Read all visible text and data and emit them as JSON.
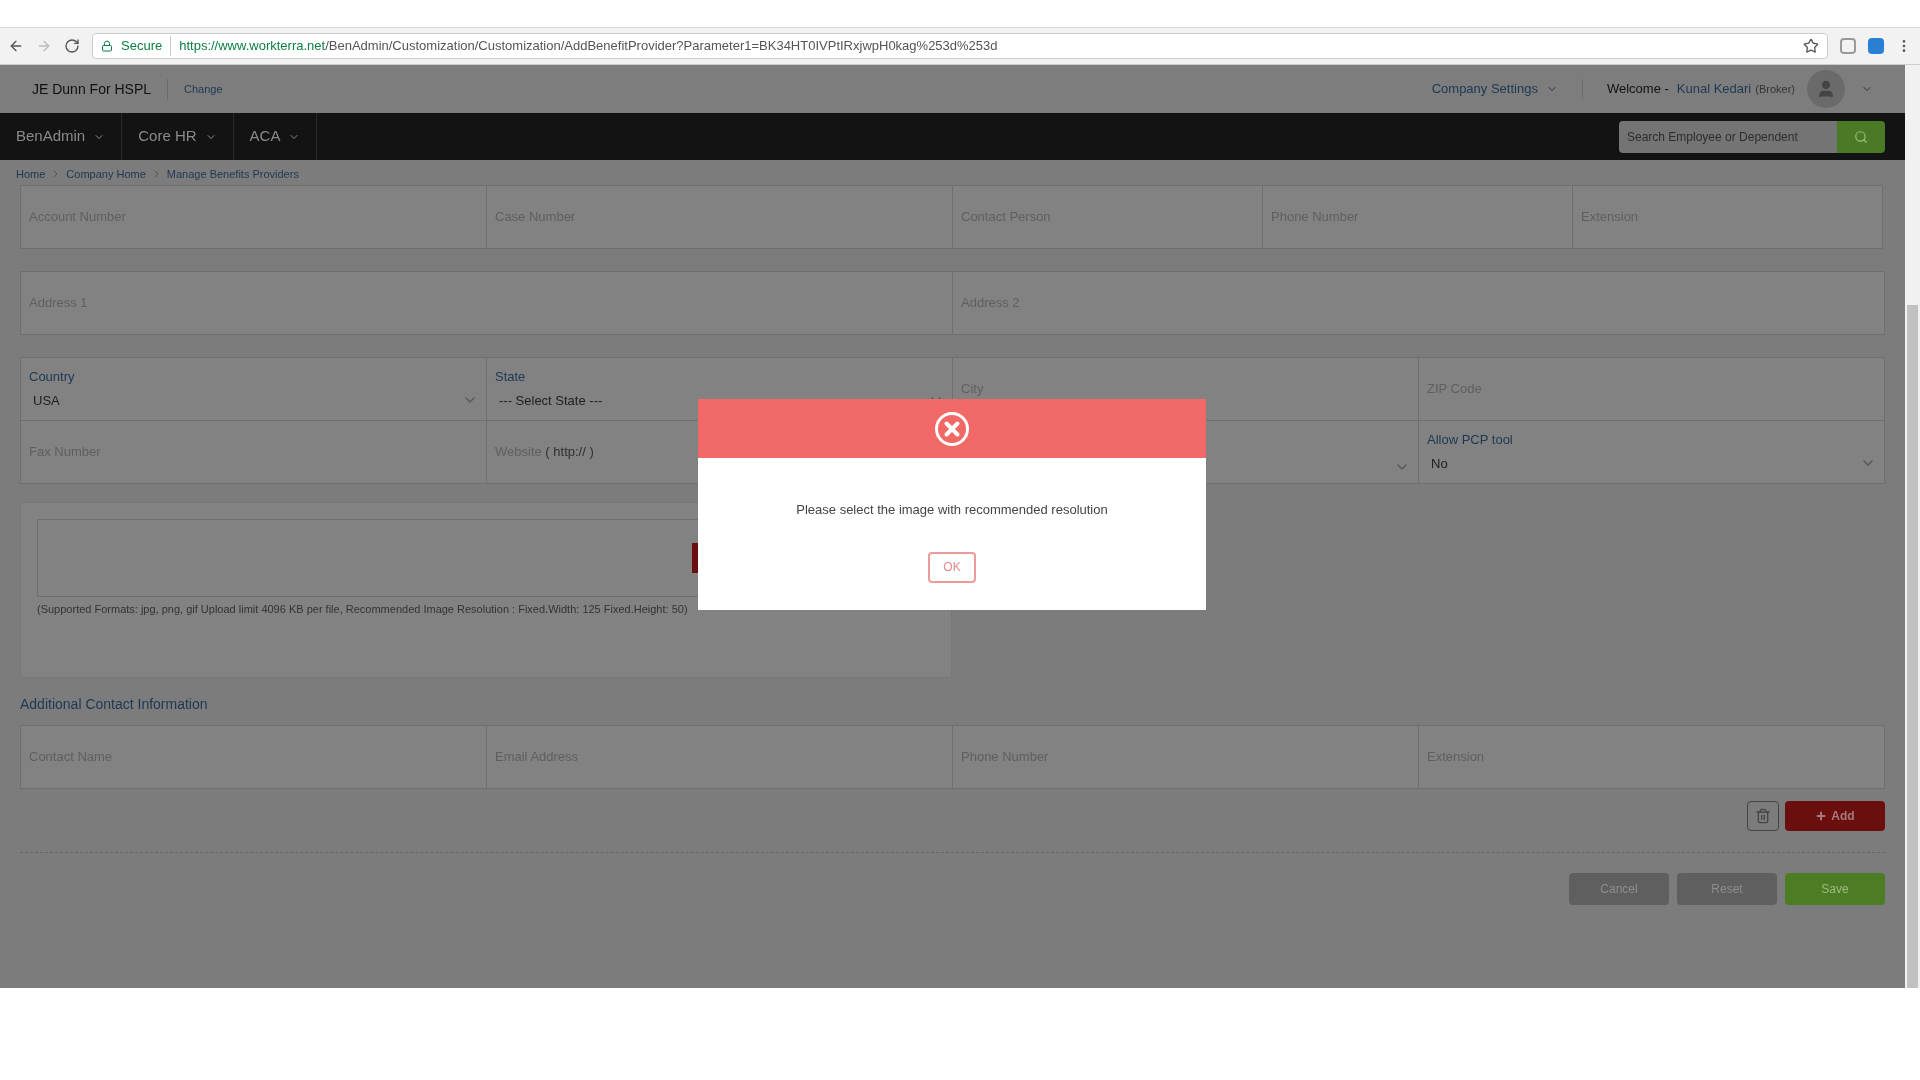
{
  "browser": {
    "secure": "Secure",
    "url_host": "https://www.workterra.net",
    "url_path": "/BenAdmin/Customization/Customization/AddBenefitProvider?Parameter1=BK34HT0IVPtIRxjwpH0kag%253d%253d"
  },
  "header": {
    "company": "JE Dunn For HSPL",
    "change": "Change",
    "company_settings": "Company Settings",
    "welcome": "Welcome -",
    "user_name": "Kunal Kedari",
    "user_role": "(Broker)"
  },
  "nav": {
    "items": [
      {
        "label": "BenAdmin"
      },
      {
        "label": "Core HR"
      },
      {
        "label": "ACA"
      }
    ],
    "search_placeholder": "Search Employee or Dependent"
  },
  "breadcrumb": [
    "Home",
    "Company Home",
    "Manage Benefits Providers"
  ],
  "form_rows": [
    {
      "fields": [
        {
          "kind": "text",
          "placeholder": "Account Number"
        },
        {
          "kind": "text",
          "placeholder": "Case Number"
        },
        {
          "kind": "text",
          "placeholder": "Contact Person"
        },
        {
          "kind": "text",
          "placeholder": "Phone Number"
        },
        {
          "kind": "text",
          "placeholder": "Extension"
        }
      ]
    },
    {
      "fields": [
        {
          "kind": "text",
          "placeholder": "Address 1"
        },
        {
          "kind": "text",
          "placeholder": "Address 2"
        }
      ]
    },
    {
      "fields": [
        {
          "kind": "select",
          "label": "Country",
          "value": "USA"
        },
        {
          "kind": "select",
          "label": "State",
          "value": "--- Select State ---"
        },
        {
          "kind": "text",
          "placeholder": "City"
        },
        {
          "kind": "text",
          "placeholder": "ZIP Code"
        },
        {
          "kind": "text",
          "placeholder": "Fax Number"
        },
        {
          "kind": "text",
          "placeholder": "Website",
          "hint": "( http:// )"
        },
        {
          "kind": "select"
        },
        {
          "kind": "select",
          "label": "Allow PCP tool",
          "value": "No"
        }
      ]
    }
  ],
  "upload": {
    "note": "(Supported Formats: jpg, png, gif Upload limit 4096 KB per file, Recommended Image Resolution : Fixed.Width: 125 Fixed.Height: 50)"
  },
  "additional_contacts": {
    "title": "Additional Contact Information",
    "fields": [
      "Contact Name",
      "Email Address",
      "Phone Number",
      "Extension"
    ]
  },
  "add_button": "Add",
  "actions": [
    {
      "kind": "cancel",
      "label": "Cancel"
    },
    {
      "kind": "reset",
      "label": "Reset"
    },
    {
      "kind": "save",
      "label": "Save"
    }
  ],
  "modal": {
    "message": "Please select the image with recommended resolution",
    "ok": "OK"
  }
}
